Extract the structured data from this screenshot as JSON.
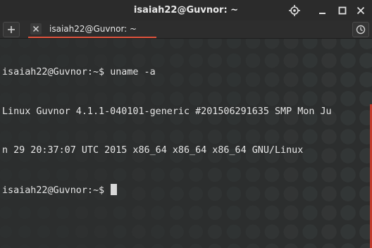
{
  "window": {
    "title": "isaiah22@Guvnor: ~"
  },
  "tabs": [
    {
      "label": "isaiah22@Guvnor: ~",
      "active": true
    }
  ],
  "terminal": {
    "lines": [
      {
        "prompt": "isaiah22@Guvnor:~$ ",
        "command": "uname -a"
      },
      {
        "output": "Linux Guvnor 4.1.1-040101-generic #201506291635 SMP Mon Ju"
      },
      {
        "output": "n 29 20:37:07 UTC 2015 x86_64 x86_64 x86_64 GNU/Linux"
      },
      {
        "prompt": "isaiah22@Guvnor:~$ ",
        "command": ""
      }
    ]
  },
  "colors": {
    "accent": "#e0533c",
    "scroll_indicator": "#c2392b",
    "background": "#2c2e2e",
    "text": "#e6e6e6"
  },
  "icons": {
    "new_tab": "plus-icon",
    "tab_close": "close-icon",
    "history": "history-icon",
    "titlebar": [
      "crosshair-icon",
      "minimize-icon",
      "maximize-icon",
      "close-icon"
    ]
  }
}
